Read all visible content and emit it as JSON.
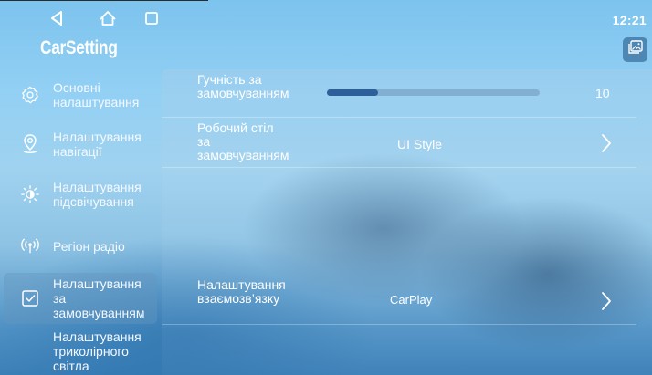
{
  "system_bar": {
    "time": "12:21",
    "back_icon": "back-triangle-icon",
    "home_icon": "home-icon",
    "recents_icon": "recents-square-icon"
  },
  "app": {
    "title": "CarSetting",
    "wallpaper_icon": "wallpaper-icon"
  },
  "sidebar": {
    "items": [
      {
        "label": "Основні налаштування",
        "icon": "gear-icon",
        "active": false
      },
      {
        "label": "Налаштування навігації",
        "icon": "location-pin-icon",
        "active": false
      },
      {
        "label": "Налаштування підсвічування",
        "icon": "brightness-icon",
        "active": false
      },
      {
        "label": "Регіон радіо",
        "icon": "radio-signal-icon",
        "active": false
      },
      {
        "label": "Налаштування за замовчуванням",
        "icon": "checkbox-icon",
        "active": true
      },
      {
        "label": "Налаштування триколірного світла",
        "icon": "",
        "active": false
      }
    ]
  },
  "settings": {
    "volume": {
      "label": "Гучність за замовчуванням",
      "value": "10",
      "level": 0.24
    },
    "desktop": {
      "label": "Робочий стіл за замовчуванням",
      "value": "UI Style"
    },
    "connection": {
      "label": "Налаштування взаємозв’язку",
      "value": "CarPlay"
    }
  },
  "colors": {
    "accent": "#2d5f9a",
    "text": "#ffffff"
  }
}
